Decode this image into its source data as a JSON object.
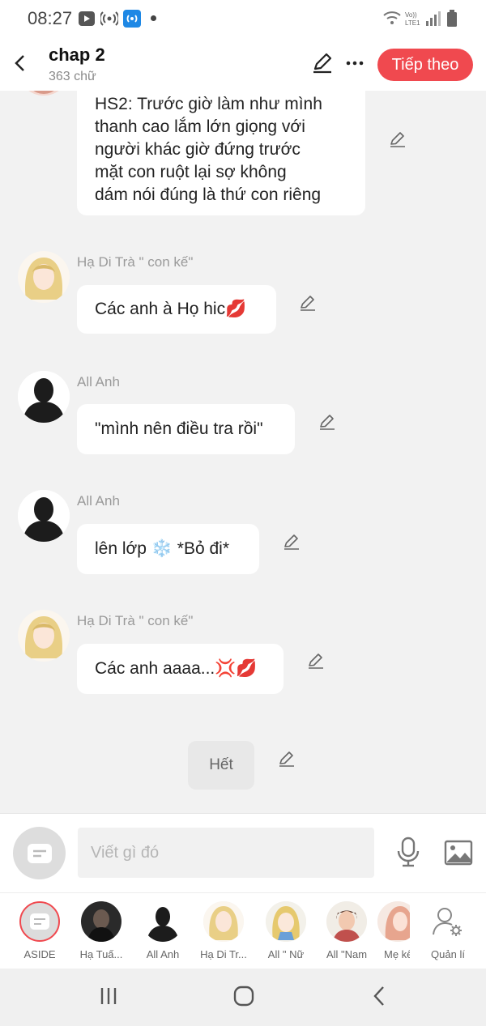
{
  "status_bar": {
    "time": "08:27"
  },
  "header": {
    "title": "chap 2",
    "subtitle": "363 chữ",
    "next_label": "Tiếp theo"
  },
  "messages": [
    {
      "sender": "",
      "text_lines": [
        "HS2: Trước giờ làm như mình",
        "thanh cao lắm lớn giọng với",
        "người khác giờ đứng trước",
        "mặt con ruột lại sợ không",
        "dám nói đúng là thứ con riêng"
      ]
    },
    {
      "sender": "Hạ Di Trà \" con kế\"",
      "text": "Các anh à Họ hic💋"
    },
    {
      "sender": "All Anh",
      "text": "\"mình nên điều tra rồi\""
    },
    {
      "sender": "All Anh",
      "text": "lên lớp ❄️ *Bỏ đi*"
    },
    {
      "sender": "Hạ Di Trà \" con kế\"",
      "text": "Các anh aaaa...💢💋"
    }
  ],
  "end_label": "Hết",
  "composer": {
    "placeholder": "Viết gì đó"
  },
  "characters": [
    {
      "name": "ASIDE"
    },
    {
      "name": "Hạ Tuấ..."
    },
    {
      "name": "All Anh"
    },
    {
      "name": "Hạ Di Tr..."
    },
    {
      "name": "All \" Nữ"
    },
    {
      "name": "All \"Nam"
    },
    {
      "name": "Mẹ kế"
    },
    {
      "name": "Quản lí"
    }
  ],
  "colors": {
    "accent": "#f0494f",
    "background": "#f2f2f2"
  }
}
